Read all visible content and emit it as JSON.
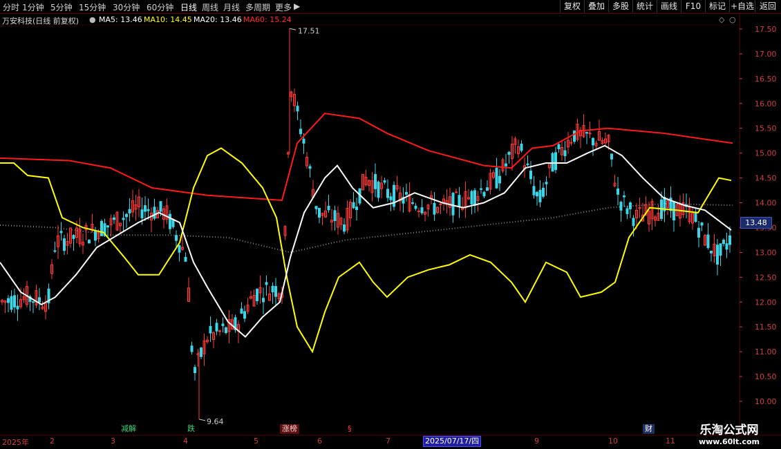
{
  "toolbar": {
    "timeframes": [
      "分时",
      "1分钟",
      "5分钟",
      "15分钟",
      "30分钟",
      "60分钟",
      "日线",
      "周线",
      "月线",
      "多周期",
      "更多"
    ],
    "active_timeframe": "日线",
    "right_buttons": [
      "复权",
      "叠加",
      "多股",
      "统计",
      "画线",
      "F10",
      "标记",
      "+自选",
      "返回"
    ]
  },
  "info": {
    "title": "万安科技(日线 前复权)",
    "ma5": "MA5: 13.46",
    "ma10": "MA10: 14.45",
    "ma20": "MA20: 13.46",
    "ma60": "MA60: 15.24"
  },
  "colors": {
    "up": "#ff3b3b",
    "down": "#3ad6e8",
    "ma5": "#ffffff",
    "ma10": "#ffff00",
    "ma20": "#ffffff",
    "ma60": "#ff1a1a",
    "axis": "#d04040",
    "grid": "#5a0000"
  },
  "annotations": {
    "high": "17.51",
    "low": "9.64"
  },
  "y_axis": {
    "ticks": [
      "17.50",
      "17.00",
      "16.50",
      "16.00",
      "15.50",
      "15.00",
      "14.50",
      "14.00",
      "13.50",
      "13.00",
      "12.50",
      "12.00",
      "11.50",
      "11.00",
      "10.50",
      "10.00"
    ],
    "min": 9.64,
    "max": 17.51
  },
  "current_price": "13.48",
  "flags": [
    {
      "label": "减解",
      "color": "#3ad67a"
    },
    {
      "label": "跌",
      "color": "#3ad67a"
    },
    {
      "label": "涨榜",
      "color": "#ff6060"
    },
    {
      "label": "§",
      "color": "#ff3b3b"
    },
    {
      "label": "财",
      "color": "#6aa0ff"
    }
  ],
  "date_axis": {
    "labels": [
      "2025年",
      "2",
      "3",
      "4",
      "5",
      "6",
      "7",
      "9",
      "10",
      "11"
    ],
    "selected": "2025/07/17/四"
  },
  "watermark": {
    "line1": "乐淘公式网",
    "line2": "www.60lt.com"
  },
  "icons": {
    "toolbar_more": "chevron-right-icon",
    "info_toggle": "circle-toggle-icon",
    "corner": "diamond-icon"
  }
}
